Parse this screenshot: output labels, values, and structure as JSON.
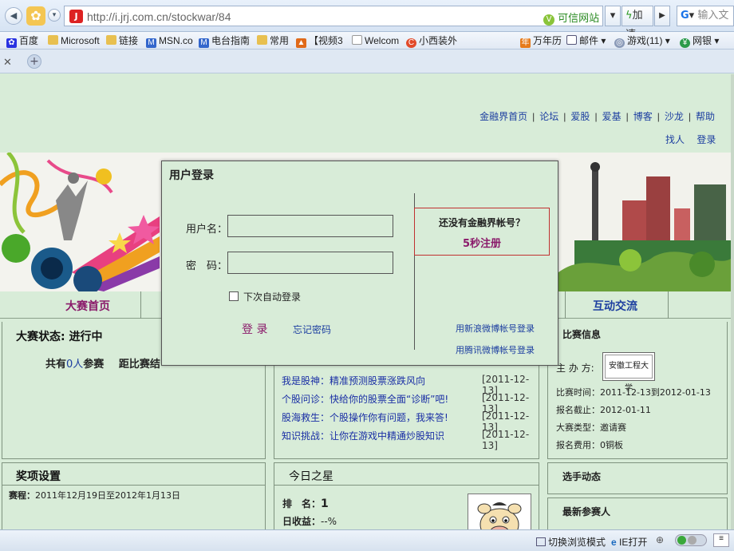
{
  "browser": {
    "url": "http://i.jrj.com.cn/stockwar/84",
    "trusted_label": "可信网站",
    "speed_label": "加速",
    "search_placeholder": "输入文",
    "favorites": [
      "百度",
      "Microsoft",
      "链接",
      "MSN.co",
      "电台指南",
      "常用",
      "【视频3",
      "Welcom",
      "小西装外"
    ],
    "fav_right": [
      "万年历",
      "邮件",
      "游戏(11)",
      "网银"
    ],
    "status_items": [
      "切换浏览模式",
      "IE打开"
    ]
  },
  "top_links": [
    "金融界首页",
    "论坛",
    "爱股",
    "爱基",
    "博客",
    "沙龙",
    "帮助"
  ],
  "user_links": [
    "找人",
    "登录"
  ],
  "nav": [
    "大赛首页",
    "互动交流"
  ],
  "status_panel": {
    "title": "大赛状态: 进行中",
    "participants_prefix": "共有",
    "participants_count": "0人",
    "participants_suffix": "参赛",
    "countdown_label": "距比赛结"
  },
  "news": [
    {
      "text": "我是股神：精准预测股票涨跌风向",
      "date": "[2011-12-13]"
    },
    {
      "text": "个股问诊：快给你的股票全面“诊断”吧!",
      "date": "[2011-12-13]"
    },
    {
      "text": "股海救生：个股操作你有问题，我来答!",
      "date": "[2011-12-13]"
    },
    {
      "text": "知识挑战：让你在游戏中精通炒股知识",
      "date": "[2011-12-13]"
    }
  ],
  "contest_info": {
    "title": "比赛信息",
    "organizer_label": "主 办 方:",
    "organizer": "安徽工程大学",
    "rows": [
      "比赛时间：2011-12-13到2012-01-13",
      "报名截止：2012-01-11",
      "大赛类型：邀请赛",
      "报名费用：0铜板"
    ]
  },
  "awards": {
    "title": "奖项设置",
    "period_label": "赛程：",
    "period": "2011年12月19日至2012年1月13日"
  },
  "star": {
    "title": "今日之星",
    "rank_label": "排　名：",
    "rank": "1",
    "income_label": "日收益：",
    "income": "--%"
  },
  "side": {
    "player_news": "选手动态",
    "newest": "最新参赛人"
  },
  "login": {
    "title": "用户登录",
    "username_label": "用户名：",
    "password_label": "密　码：",
    "remember_label": "下次自动登录",
    "login_button": "登 录",
    "forgot": "忘记密码",
    "no_account": "还没有金融界帐号？",
    "register": "5秒注册",
    "sina_login": "用新浪微博帐号登录",
    "qq_login": "用腾讯微博帐号登录"
  }
}
